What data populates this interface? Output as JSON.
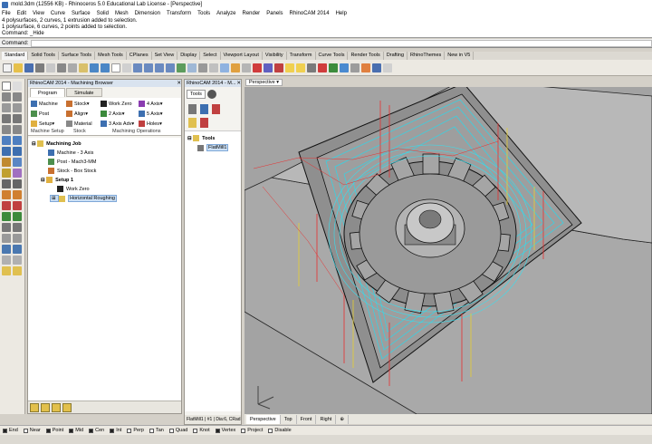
{
  "window": {
    "title": "mold.3dm (12556 KB) - Rhinoceros 5.0 Educational Lab License - [Perspective]"
  },
  "menu": [
    "File",
    "Edit",
    "View",
    "Curve",
    "Surface",
    "Solid",
    "Mesh",
    "Dimension",
    "Transform",
    "Tools",
    "Analyze",
    "Render",
    "Panels",
    "RhinoCAM 2014",
    "Help"
  ],
  "history": [
    "4 polysurfaces, 2 curves, 1 extrusion added to selection.",
    "1 polysurface, 6 curves, 2 points added to selection.",
    "Command: _Hide"
  ],
  "command": {
    "label": "Command:"
  },
  "toolbar_tabs": [
    "Standard",
    "Solid Tools",
    "Surface Tools",
    "Mesh Tools",
    "CPlanes",
    "Set View",
    "Display",
    "Select",
    "Viewport Layout",
    "Visibility",
    "Transform",
    "Curve Tools",
    "Render Tools",
    "Drafting",
    "RhinoThemes",
    "New in V5"
  ],
  "machining_browser": {
    "title": "RhinoCAM 2014 - Machining Browser",
    "tabs": [
      "Program",
      "Simulate"
    ],
    "ribbon": {
      "machine": "Machine",
      "post": "Post",
      "setup": "Setup",
      "stock": "Stock",
      "align": "Align",
      "material": "Material",
      "work_zero": "Work Zero",
      "axis2": "2 Axis",
      "axis3adv": "3 Axis Adv",
      "axis4": "4 Axis",
      "axis5": "5 Axis",
      "holes": "Holes",
      "group_setup": "Machine Setup",
      "group_stock": "Stock",
      "group_ops": "Machining Operations"
    },
    "tree": {
      "job": "Machining Job",
      "machine": "Machine - 3 Axis",
      "post": "Post - Mach3-MM",
      "stock": "Stock - Box Stock",
      "setup": "Setup 1",
      "work_zero": "Work Zero",
      "roughing": "Horizontal Roughing"
    }
  },
  "tools_panel": {
    "title": "RhinoCAM 2014 - M...",
    "tab": "Tools",
    "root": "Tools",
    "item": "FlatMill1",
    "footer": "FlatMill1 | #1 | Dia:6, CRad:"
  },
  "viewport": {
    "tab": "Perspective",
    "view_tabs": [
      "Perspective",
      "Top",
      "Front",
      "Right"
    ]
  },
  "osnaps": [
    {
      "label": "End",
      "on": true
    },
    {
      "label": "Near",
      "on": false
    },
    {
      "label": "Point",
      "on": true
    },
    {
      "label": "Mid",
      "on": true
    },
    {
      "label": "Cen",
      "on": true
    },
    {
      "label": "Int",
      "on": true
    },
    {
      "label": "Perp",
      "on": false
    },
    {
      "label": "Tan",
      "on": false
    },
    {
      "label": "Quad",
      "on": false
    },
    {
      "label": "Knot",
      "on": false
    },
    {
      "label": "Vertex",
      "on": true
    },
    {
      "label": "Project",
      "on": false
    },
    {
      "label": "Disable",
      "on": false
    }
  ]
}
